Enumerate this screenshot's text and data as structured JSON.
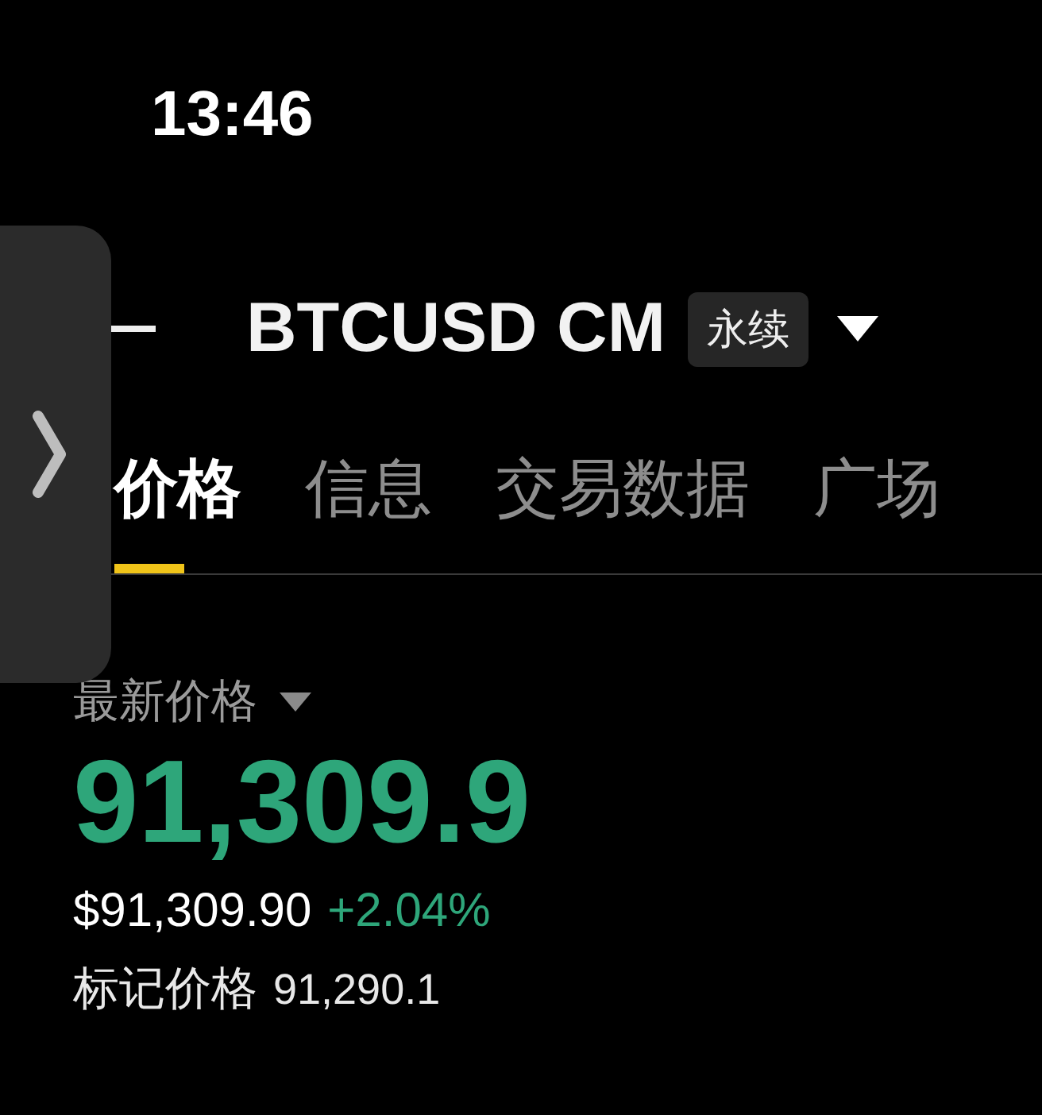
{
  "status_bar": {
    "time": "13:46"
  },
  "header": {
    "title": "BTCUSD CM",
    "badge": "永续"
  },
  "tabs": [
    {
      "label": "价格",
      "selected": true
    },
    {
      "label": "信息",
      "selected": false
    },
    {
      "label": "交易数据",
      "selected": false
    },
    {
      "label": "广场",
      "selected": false
    }
  ],
  "price": {
    "label": "最新价格",
    "last": "91,309.9",
    "usd": "$91,309.90",
    "change": "+2.04%",
    "mark_label": "标记价格",
    "mark": "91,290.1"
  }
}
